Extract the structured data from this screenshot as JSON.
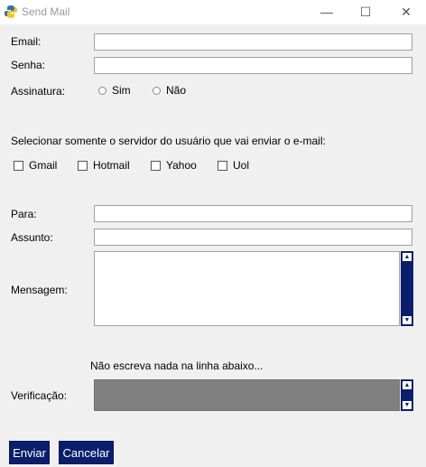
{
  "window": {
    "title": "Send Mail"
  },
  "form": {
    "email_label": "Email:",
    "senha_label": "Senha:",
    "assinatura_label": "Assinatura:",
    "assinatura_options": [
      "Sim",
      "Não"
    ],
    "server_prompt": "Selecionar somente o servidor do usuário que vai enviar o e-mail:",
    "servers": [
      "Gmail",
      "Hotmail",
      "Yahoo",
      "Uol"
    ],
    "para_label": "Para:",
    "assunto_label": "Assunto:",
    "mensagem_label": "Mensagem:",
    "warning_text": "Não escreva nada na linha abaixo...",
    "verificacao_label": "Verificação:"
  },
  "buttons": {
    "send": "Enviar",
    "cancel": "Cancelar"
  },
  "colors": {
    "accent": "#0a1f6b",
    "verification_bg": "#808080"
  }
}
